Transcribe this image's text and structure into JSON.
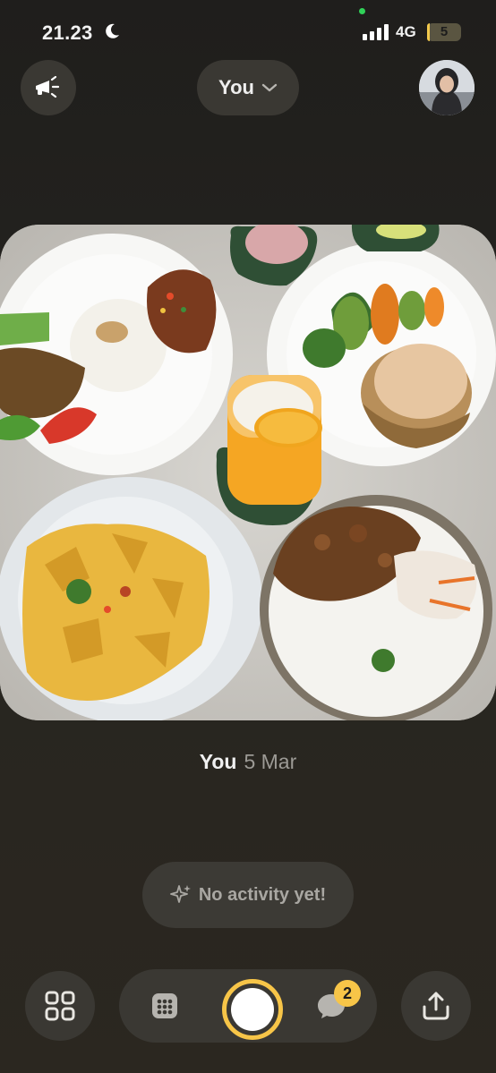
{
  "status_bar": {
    "time": "21.23",
    "network": "4G",
    "battery": "5",
    "battery_level": 0.05
  },
  "header": {
    "audience_label": "You",
    "icons": {
      "left": "megaphone-icon",
      "dropdown": "chevron-down-icon",
      "right": "avatar"
    }
  },
  "post": {
    "author": "You",
    "date": "5 Mar",
    "image_subject": "food photo"
  },
  "activity": {
    "label": "No activity yet!",
    "icon": "sparkle-icon"
  },
  "bottom_nav": {
    "icons": [
      "grid-icon",
      "calendar-icon",
      "shutter-button",
      "chat-icon",
      "share-icon"
    ],
    "chat_badge": "2"
  },
  "colors": {
    "accent": "#f7c548",
    "background": "#232220",
    "surface": "#3a3833"
  }
}
